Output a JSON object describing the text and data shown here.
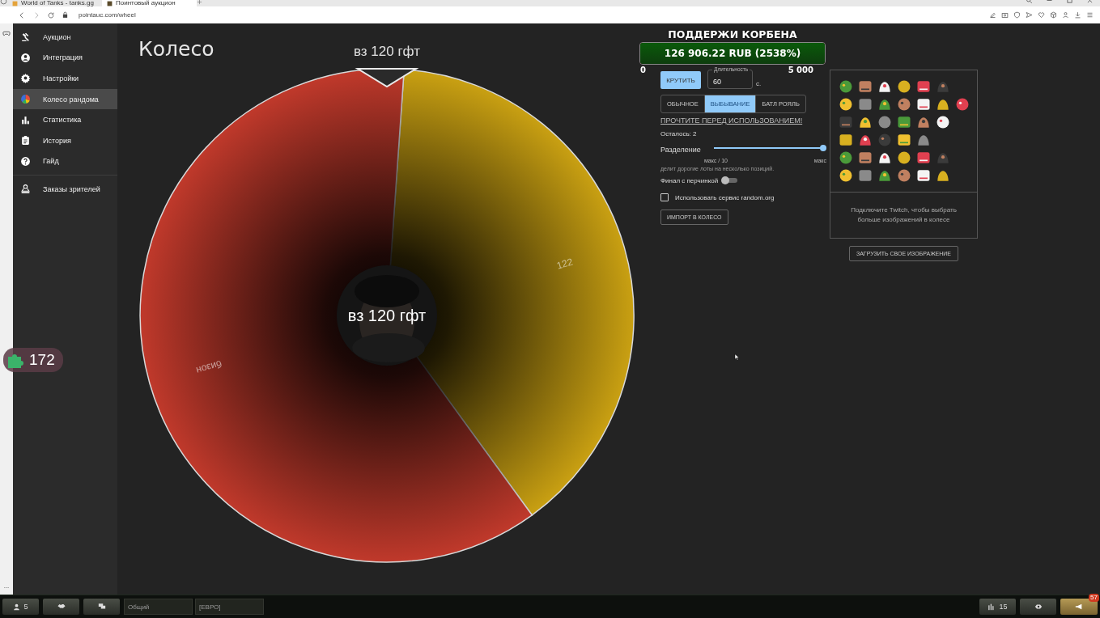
{
  "browser": {
    "tabs": [
      {
        "title": "World of Tanks - tanks.gg",
        "selected": false
      },
      {
        "title": "Поинтовый аукцион",
        "selected": true
      }
    ],
    "url": "pointauc.com/wheel"
  },
  "sidebar": {
    "groups": [
      {
        "items": [
          {
            "label": "Аукцион",
            "selected": false
          },
          {
            "label": "Интеграция",
            "selected": false
          },
          {
            "label": "Настройки",
            "selected": false
          },
          {
            "label": "Колесо рандома",
            "selected": true
          },
          {
            "label": "Статистика",
            "selected": false
          },
          {
            "label": "История",
            "selected": false
          },
          {
            "label": "Гайд",
            "selected": false
          }
        ]
      },
      {
        "items": [
          {
            "label": "Заказы зрителей",
            "selected": false
          }
        ]
      }
    ]
  },
  "page": {
    "title": "Колесо"
  },
  "wheel": {
    "winner_label": "вз 120 гфт",
    "center_label": "вз 120 гфт",
    "slices": [
      {
        "label": "122",
        "color": "#c9a012"
      },
      {
        "label": "бизон",
        "color": "#c0392b"
      }
    ]
  },
  "left_strip": {
    "more": "..."
  },
  "controls": {
    "spin_button": "КРУТИТЬ",
    "duration": {
      "label": "Длительность",
      "value": "60",
      "unit": "с."
    },
    "modes": [
      {
        "label": "ОБЫЧНОЕ",
        "selected": false
      },
      {
        "label": "ВЫБЫВАНИЕ",
        "selected": true
      },
      {
        "label": "БАТЛ РОЯЛЬ",
        "selected": false
      }
    ],
    "help_link": "ПРОЧТИТЕ ПЕРЕД ИСПОЛЬЗОВАНИЕМ!",
    "remaining": "Осталось: 2",
    "split": {
      "label": "Разделение",
      "level": 1,
      "min_label": "макс / 10",
      "max_label": "макс",
      "hint": "делит дорогие лоты на несколько позиций."
    },
    "spicy_final": {
      "label": "Финал с перчинкой",
      "on": false
    },
    "random_org": {
      "label": "Использовать сервис random.org",
      "checked": false
    },
    "import_button": "ИМПОРТ В КОЛЕСО"
  },
  "images": {
    "note": "Подключите Twitch, чтобы выбрать больше изображений в колесе",
    "upload_button": "ЗАГРУЗИТЬ СВОЕ ИЗОБРАЖЕНИЕ"
  },
  "donation": {
    "title": "ПОДДЕРЖИ КОРБЕНА",
    "amount": "126 906.22 RUB (2538%)",
    "level": 1,
    "min": "0",
    "max": "5 000"
  },
  "overlay_counter": {
    "value": "172"
  },
  "game_bar": {
    "players": "5",
    "channels": [
      "Общий",
      "[ЕВРО]"
    ],
    "online": "15",
    "notifications": "57"
  }
}
